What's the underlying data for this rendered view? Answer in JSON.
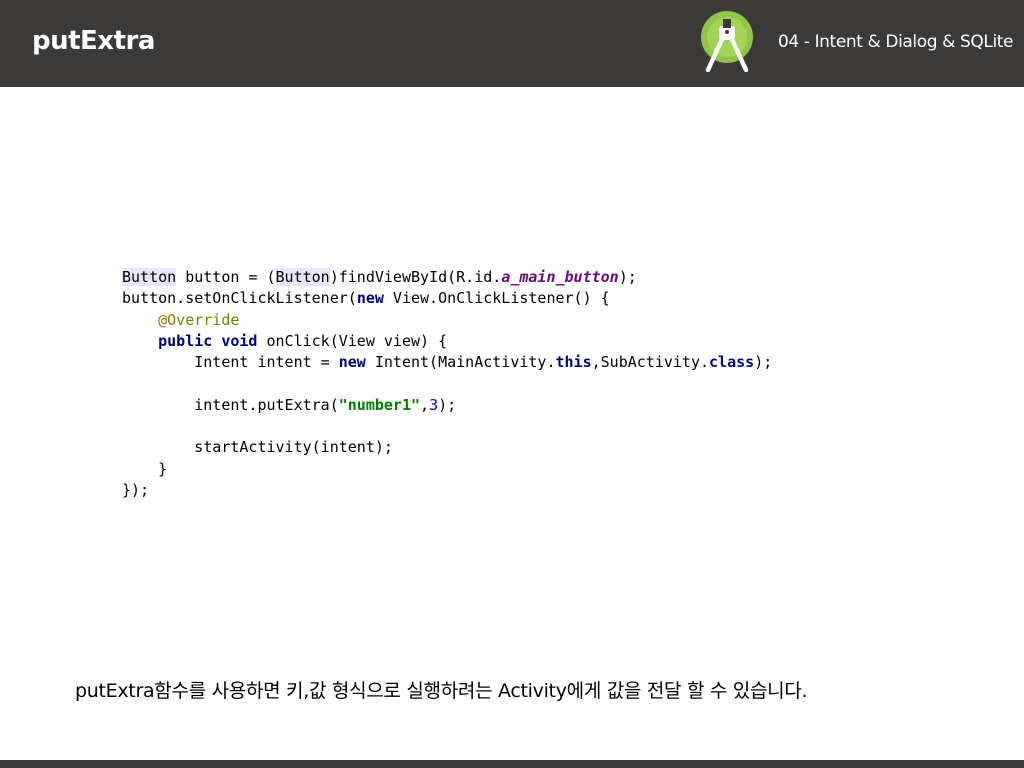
{
  "header": {
    "title": "putExtra",
    "subtitle": "04 - Intent & Dialog & SQLite",
    "logo_icon": "android-studio-icon"
  },
  "code": {
    "lines": [
      [
        [
          "hl",
          "Button"
        ],
        [
          "",
          " button = ("
        ],
        [
          "hl",
          "Button"
        ],
        [
          "",
          ")findViewById(R.id."
        ],
        [
          "fld",
          "a_main_button"
        ],
        [
          "",
          ");"
        ]
      ],
      [
        [
          "",
          "button.setOnClickListener("
        ],
        [
          "kw",
          "new"
        ],
        [
          "",
          " View.OnClickListener() {"
        ]
      ],
      [
        [
          "",
          "    "
        ],
        [
          "ann",
          "@Override"
        ]
      ],
      [
        [
          "",
          "    "
        ],
        [
          "kw",
          "public"
        ],
        [
          "",
          " "
        ],
        [
          "kw",
          "void"
        ],
        [
          "",
          " onClick(View view) {"
        ]
      ],
      [
        [
          "",
          "        Intent intent = "
        ],
        [
          "kw",
          "new"
        ],
        [
          "",
          " Intent(MainActivity."
        ],
        [
          "kw",
          "this"
        ],
        [
          "",
          ",SubActivity."
        ],
        [
          "kw",
          "class"
        ],
        [
          "",
          ");"
        ]
      ],
      [
        [
          "",
          ""
        ]
      ],
      [
        [
          "",
          "        intent.putExtra("
        ],
        [
          "str",
          "\"number1\""
        ],
        [
          "",
          ","
        ],
        [
          "num",
          "3"
        ],
        [
          "",
          ");"
        ]
      ],
      [
        [
          "",
          ""
        ]
      ],
      [
        [
          "",
          "        startActivity(intent);"
        ]
      ],
      [
        [
          "",
          "    }"
        ]
      ],
      [
        [
          "",
          "});"
        ]
      ]
    ]
  },
  "caption": "putExtra함수를 사용하면 키,값 형식으로 실행하려는 Activity에게 값을 전달 할 수 있습니다.",
  "colors": {
    "header_bg": "#3b3a39",
    "logo_green": "#8fc647",
    "keyword": "#000080",
    "field": "#660e7a",
    "annotation": "#808000",
    "string": "#008000",
    "number": "#0000ff"
  }
}
